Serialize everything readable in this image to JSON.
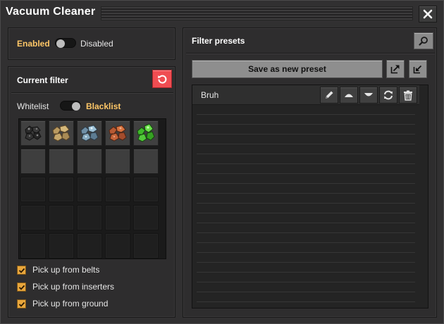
{
  "window": {
    "title": "Vacuum Cleaner"
  },
  "toggle": {
    "on_label": "Enabled",
    "off_label": "Disabled",
    "state": "Enabled"
  },
  "filter": {
    "title": "Current filter",
    "mode_left": "Whitelist",
    "mode_right": "Blacklist",
    "mode": "Blacklist",
    "items": [
      "coal",
      "stone",
      "iron-ore",
      "copper-ore",
      "uranium-ore"
    ],
    "checkboxes": [
      {
        "label": "Pick up from belts",
        "checked": true
      },
      {
        "label": "Pick up from inserters",
        "checked": true
      },
      {
        "label": "Pick up from ground",
        "checked": true
      }
    ]
  },
  "presets": {
    "title": "Filter presets",
    "save_label": "Save as new preset",
    "items": [
      {
        "name": "Bruh"
      }
    ]
  },
  "colors": {
    "accent": "#ffc767",
    "danger": "#ef4d52",
    "checkbox": "#e8a63c"
  },
  "icons": [
    "close-icon",
    "reset-icon",
    "search-icon",
    "export-icon",
    "import-icon",
    "pencil-icon",
    "move-up-icon",
    "move-down-icon",
    "refresh-icon",
    "trash-icon"
  ]
}
